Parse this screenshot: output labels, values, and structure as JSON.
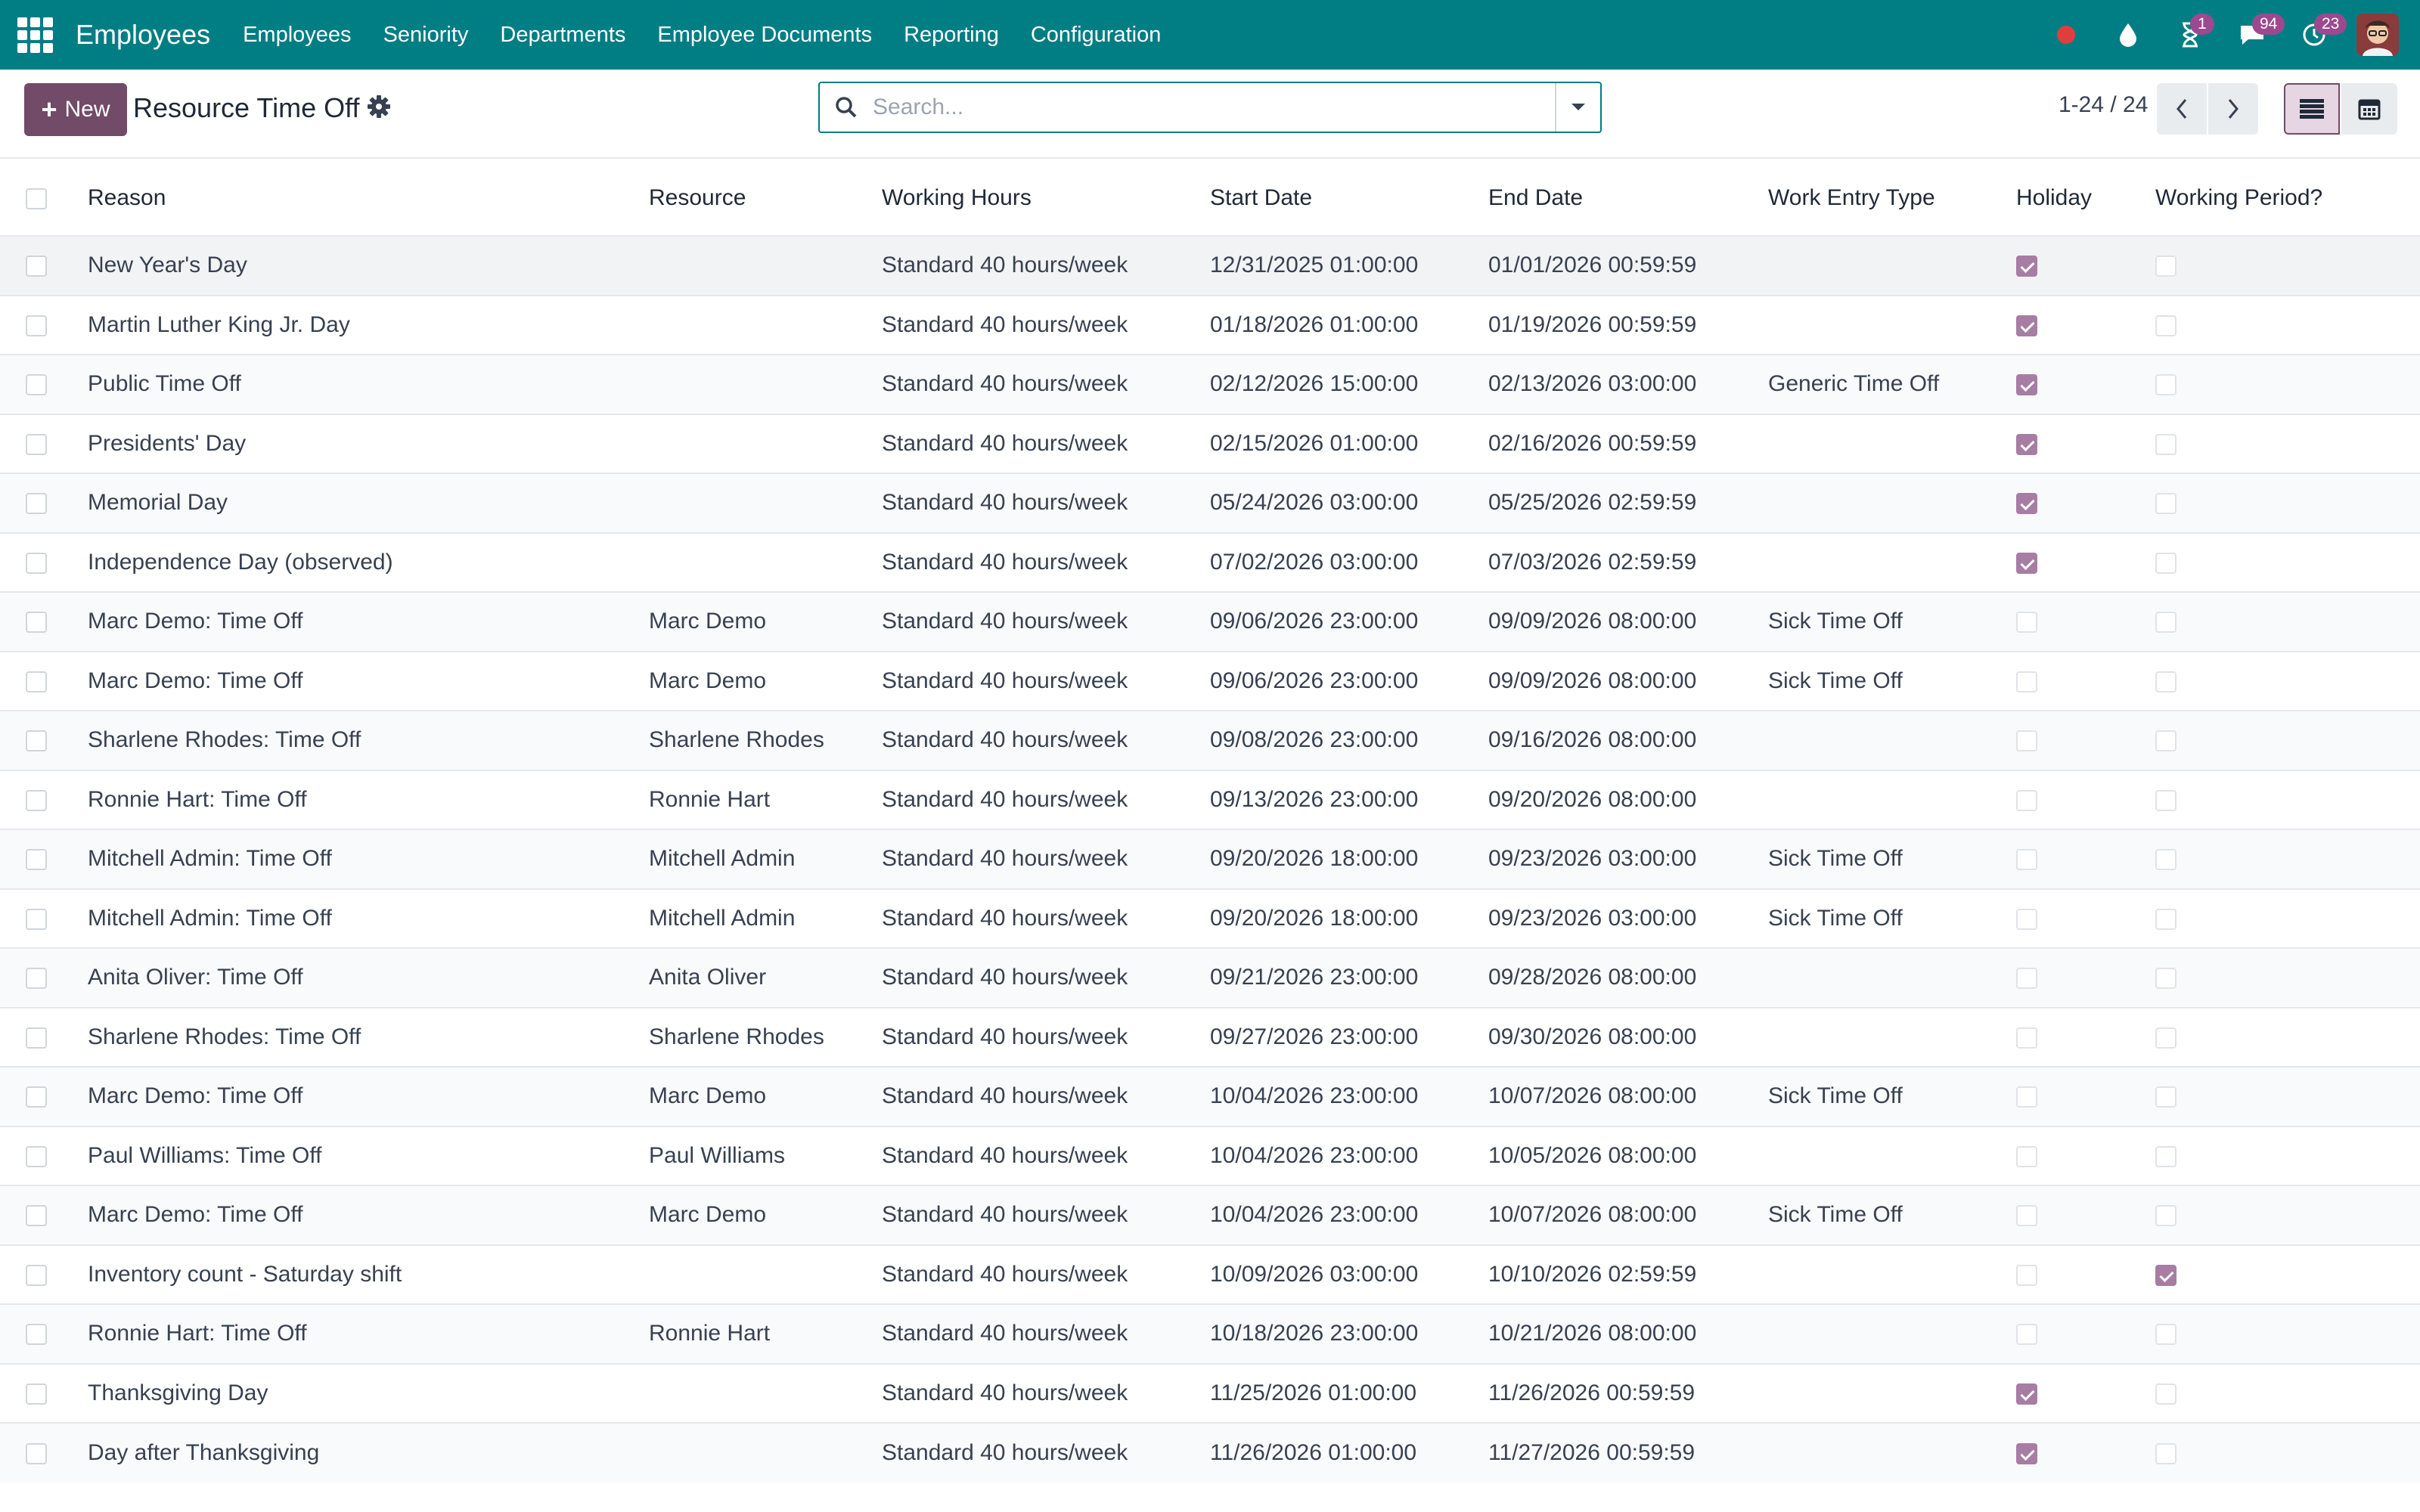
{
  "navbar": {
    "app_title": "Employees",
    "menu": [
      "Employees",
      "Seniority",
      "Departments",
      "Employee Documents",
      "Reporting",
      "Configuration"
    ],
    "activity_badge": "1",
    "messages_badge": "94",
    "timer_badge": "23",
    "status_color": "#e03e3e"
  },
  "control": {
    "new_label": "New",
    "title": "Resource Time Off",
    "search_placeholder": "Search...",
    "pager": "1-24 / 24"
  },
  "table": {
    "headers": [
      "Reason",
      "Resource",
      "Working Hours",
      "Start Date",
      "End Date",
      "Work Entry Type",
      "Holiday",
      "Working Period?"
    ],
    "rows": [
      {
        "reason": "New Year's Day",
        "resource": "",
        "hours": "Standard 40 hours/week",
        "start": "12/31/2025 01:00:00",
        "end": "01/01/2026 00:59:59",
        "type": "",
        "holiday": true,
        "working": false
      },
      {
        "reason": "Martin Luther King Jr. Day",
        "resource": "",
        "hours": "Standard 40 hours/week",
        "start": "01/18/2026 01:00:00",
        "end": "01/19/2026 00:59:59",
        "type": "",
        "holiday": true,
        "working": false
      },
      {
        "reason": "Public Time Off",
        "resource": "",
        "hours": "Standard 40 hours/week",
        "start": "02/12/2026 15:00:00",
        "end": "02/13/2026 03:00:00",
        "type": "Generic Time Off",
        "holiday": true,
        "working": false
      },
      {
        "reason": "Presidents' Day",
        "resource": "",
        "hours": "Standard 40 hours/week",
        "start": "02/15/2026 01:00:00",
        "end": "02/16/2026 00:59:59",
        "type": "",
        "holiday": true,
        "working": false
      },
      {
        "reason": "Memorial Day",
        "resource": "",
        "hours": "Standard 40 hours/week",
        "start": "05/24/2026 03:00:00",
        "end": "05/25/2026 02:59:59",
        "type": "",
        "holiday": true,
        "working": false
      },
      {
        "reason": "Independence Day (observed)",
        "resource": "",
        "hours": "Standard 40 hours/week",
        "start": "07/02/2026 03:00:00",
        "end": "07/03/2026 02:59:59",
        "type": "",
        "holiday": true,
        "working": false
      },
      {
        "reason": "Marc Demo: Time Off",
        "resource": "Marc Demo",
        "hours": "Standard 40 hours/week",
        "start": "09/06/2026 23:00:00",
        "end": "09/09/2026 08:00:00",
        "type": "Sick Time Off",
        "holiday": false,
        "working": false
      },
      {
        "reason": "Marc Demo: Time Off",
        "resource": "Marc Demo",
        "hours": "Standard 40 hours/week",
        "start": "09/06/2026 23:00:00",
        "end": "09/09/2026 08:00:00",
        "type": "Sick Time Off",
        "holiday": false,
        "working": false
      },
      {
        "reason": "Sharlene Rhodes: Time Off",
        "resource": "Sharlene Rhodes",
        "hours": "Standard 40 hours/week",
        "start": "09/08/2026 23:00:00",
        "end": "09/16/2026 08:00:00",
        "type": "",
        "holiday": false,
        "working": false
      },
      {
        "reason": "Ronnie Hart: Time Off",
        "resource": "Ronnie Hart",
        "hours": "Standard 40 hours/week",
        "start": "09/13/2026 23:00:00",
        "end": "09/20/2026 08:00:00",
        "type": "",
        "holiday": false,
        "working": false
      },
      {
        "reason": "Mitchell Admin: Time Off",
        "resource": "Mitchell Admin",
        "hours": "Standard 40 hours/week",
        "start": "09/20/2026 18:00:00",
        "end": "09/23/2026 03:00:00",
        "type": "Sick Time Off",
        "holiday": false,
        "working": false
      },
      {
        "reason": "Mitchell Admin: Time Off",
        "resource": "Mitchell Admin",
        "hours": "Standard 40 hours/week",
        "start": "09/20/2026 18:00:00",
        "end": "09/23/2026 03:00:00",
        "type": "Sick Time Off",
        "holiday": false,
        "working": false
      },
      {
        "reason": "Anita Oliver: Time Off",
        "resource": "Anita Oliver",
        "hours": "Standard 40 hours/week",
        "start": "09/21/2026 23:00:00",
        "end": "09/28/2026 08:00:00",
        "type": "",
        "holiday": false,
        "working": false
      },
      {
        "reason": "Sharlene Rhodes: Time Off",
        "resource": "Sharlene Rhodes",
        "hours": "Standard 40 hours/week",
        "start": "09/27/2026 23:00:00",
        "end": "09/30/2026 08:00:00",
        "type": "",
        "holiday": false,
        "working": false
      },
      {
        "reason": "Marc Demo: Time Off",
        "resource": "Marc Demo",
        "hours": "Standard 40 hours/week",
        "start": "10/04/2026 23:00:00",
        "end": "10/07/2026 08:00:00",
        "type": "Sick Time Off",
        "holiday": false,
        "working": false
      },
      {
        "reason": "Paul Williams: Time Off",
        "resource": "Paul Williams",
        "hours": "Standard 40 hours/week",
        "start": "10/04/2026 23:00:00",
        "end": "10/05/2026 08:00:00",
        "type": "",
        "holiday": false,
        "working": false
      },
      {
        "reason": "Marc Demo: Time Off",
        "resource": "Marc Demo",
        "hours": "Standard 40 hours/week",
        "start": "10/04/2026 23:00:00",
        "end": "10/07/2026 08:00:00",
        "type": "Sick Time Off",
        "holiday": false,
        "working": false
      },
      {
        "reason": "Inventory count - Saturday shift",
        "resource": "",
        "hours": "Standard 40 hours/week",
        "start": "10/09/2026 03:00:00",
        "end": "10/10/2026 02:59:59",
        "type": "",
        "holiday": false,
        "working": true
      },
      {
        "reason": "Ronnie Hart: Time Off",
        "resource": "Ronnie Hart",
        "hours": "Standard 40 hours/week",
        "start": "10/18/2026 23:00:00",
        "end": "10/21/2026 08:00:00",
        "type": "",
        "holiday": false,
        "working": false
      },
      {
        "reason": "Thanksgiving Day",
        "resource": "",
        "hours": "Standard 40 hours/week",
        "start": "11/25/2026 01:00:00",
        "end": "11/26/2026 00:59:59",
        "type": "",
        "holiday": true,
        "working": false
      },
      {
        "reason": "Day after Thanksgiving",
        "resource": "",
        "hours": "Standard 40 hours/week",
        "start": "11/26/2026 01:00:00",
        "end": "11/27/2026 00:59:59",
        "type": "",
        "holiday": true,
        "working": false
      }
    ]
  }
}
